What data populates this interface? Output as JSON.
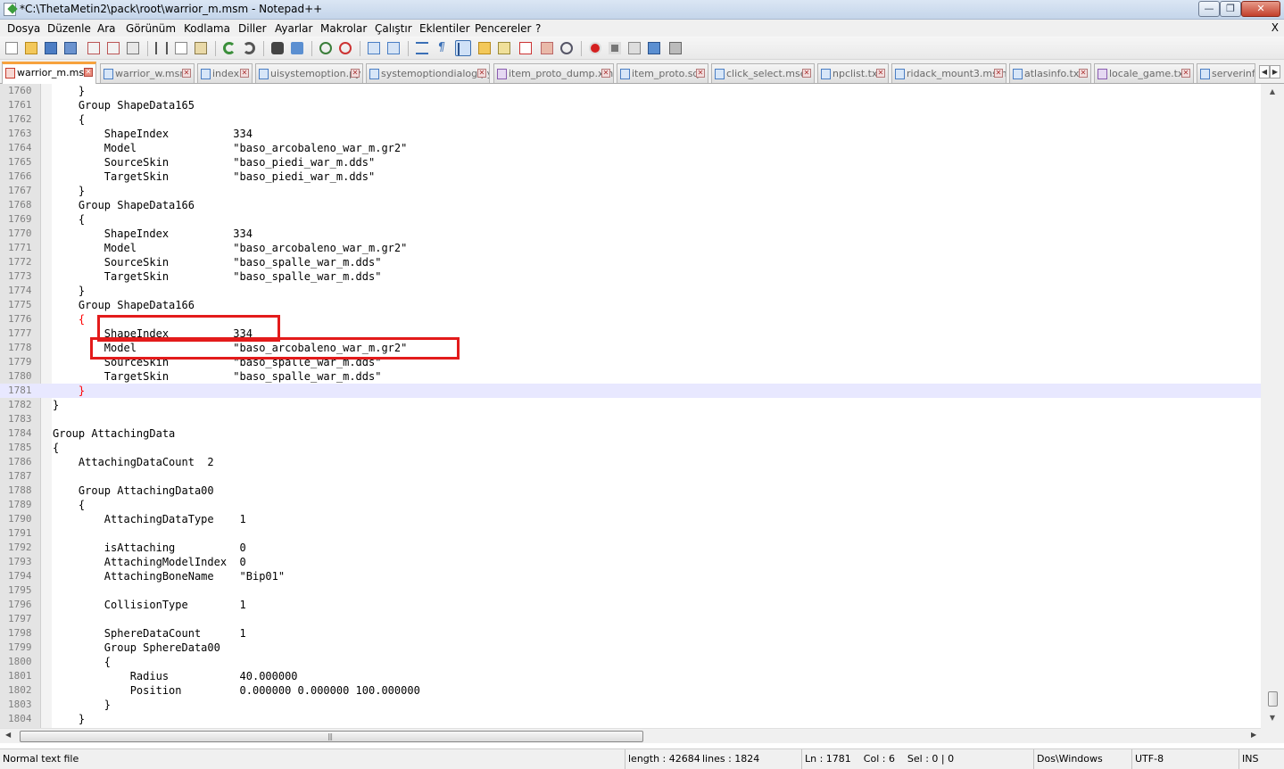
{
  "window": {
    "title": "*C:\\ThetaMetin2\\pack\\root\\warrior_m.msm - Notepad++",
    "buttons": {
      "minimize": "—",
      "maximize": "❐",
      "close": "✕"
    }
  },
  "menu": {
    "items": [
      "Dosya",
      "Düzenle",
      "Ara",
      "Görünüm",
      "Kodlama",
      "Diller",
      "Ayarlar",
      "Makrolar",
      "Çalıştır",
      "Eklentiler",
      "Pencereler",
      "?"
    ],
    "close_label": "X"
  },
  "toolbar": {
    "icons": [
      "new-file-icon",
      "open-file-icon",
      "save-icon",
      "save-all-icon",
      "close-icon",
      "close-all-icon",
      "print-icon",
      "cut-icon",
      "copy-icon",
      "paste-icon",
      "undo-icon",
      "redo-icon",
      "find-icon",
      "replace-icon",
      "zoom-in-icon",
      "zoom-out-icon",
      "sync-vertical-icon",
      "sync-horizontal-icon",
      "word-wrap-icon",
      "show-all-chars-icon",
      "indent-guide-icon",
      "user-language-icon",
      "document-map-icon",
      "function-list-icon",
      "folder-workspace-icon",
      "monitor-icon",
      "record-macro-icon",
      "stop-macro-icon",
      "play-macro-icon",
      "run-macro-multiple-icon",
      "save-macro-icon"
    ],
    "colors": {
      "accent": "#3b6fb0",
      "record": "#d42020"
    }
  },
  "tabs": [
    {
      "label": "warrior_m.msm",
      "active": true
    },
    {
      "label": "warrior_w.msm",
      "active": false
    },
    {
      "label": "index",
      "active": false
    },
    {
      "label": "uisystemoption.py",
      "active": false
    },
    {
      "label": "systemoptiondialog.py",
      "active": false
    },
    {
      "label": "item_proto_dump.xml",
      "active": false
    },
    {
      "label": "item_proto.sql",
      "active": false
    },
    {
      "label": "click_select.mse",
      "active": false
    },
    {
      "label": "npclist.txt",
      "active": false
    },
    {
      "label": "ridack_mount3.msm",
      "active": false
    },
    {
      "label": "atlasinfo.txt",
      "active": false
    },
    {
      "label": "locale_game.txt",
      "active": false
    },
    {
      "label": "serverinfo",
      "active": false
    }
  ],
  "editor": {
    "current_line": 1781,
    "lines": [
      {
        "n": "1760",
        "text": "    }"
      },
      {
        "n": "1761",
        "text": "    Group ShapeData165"
      },
      {
        "n": "1762",
        "text": "    {"
      },
      {
        "n": "1763",
        "text": "        ShapeIndex          334"
      },
      {
        "n": "1764",
        "text": "        Model               \"baso_arcobaleno_war_m.gr2\""
      },
      {
        "n": "1765",
        "text": "        SourceSkin          \"baso_piedi_war_m.dds\""
      },
      {
        "n": "1766",
        "text": "        TargetSkin          \"baso_piedi_war_m.dds\""
      },
      {
        "n": "1767",
        "text": "    }"
      },
      {
        "n": "1768",
        "text": "    Group ShapeData166"
      },
      {
        "n": "1769",
        "text": "    {"
      },
      {
        "n": "1770",
        "text": "        ShapeIndex          334"
      },
      {
        "n": "1771",
        "text": "        Model               \"baso_arcobaleno_war_m.gr2\""
      },
      {
        "n": "1772",
        "text": "        SourceSkin          \"baso_spalle_war_m.dds\""
      },
      {
        "n": "1773",
        "text": "        TargetSkin          \"baso_spalle_war_m.dds\""
      },
      {
        "n": "1774",
        "text": "    }"
      },
      {
        "n": "1775",
        "text": "    Group ShapeData166"
      },
      {
        "n": "1776",
        "text": "    {",
        "brace": true
      },
      {
        "n": "1777",
        "text": "        ShapeIndex          334"
      },
      {
        "n": "1778",
        "text": "        Model               \"baso_arcobaleno_war_m.gr2\""
      },
      {
        "n": "1779",
        "text": "        SourceSkin          \"baso_spalle_war_m.dds\""
      },
      {
        "n": "1780",
        "text": "        TargetSkin          \"baso_spalle_war_m.dds\""
      },
      {
        "n": "1781",
        "text": "    }",
        "brace": true,
        "current": true
      },
      {
        "n": "1782",
        "text": "}"
      },
      {
        "n": "1783",
        "text": ""
      },
      {
        "n": "1784",
        "text": "Group AttachingData"
      },
      {
        "n": "1785",
        "text": "{"
      },
      {
        "n": "1786",
        "text": "    AttachingDataCount  2"
      },
      {
        "n": "1787",
        "text": ""
      },
      {
        "n": "1788",
        "text": "    Group AttachingData00"
      },
      {
        "n": "1789",
        "text": "    {"
      },
      {
        "n": "1790",
        "text": "        AttachingDataType    1"
      },
      {
        "n": "1791",
        "text": ""
      },
      {
        "n": "1792",
        "text": "        isAttaching          0"
      },
      {
        "n": "1793",
        "text": "        AttachingModelIndex  0"
      },
      {
        "n": "1794",
        "text": "        AttachingBoneName    \"Bip01\""
      },
      {
        "n": "1795",
        "text": ""
      },
      {
        "n": "1796",
        "text": "        CollisionType        1"
      },
      {
        "n": "1797",
        "text": ""
      },
      {
        "n": "1798",
        "text": "        SphereDataCount      1"
      },
      {
        "n": "1799",
        "text": "        Group SphereData00"
      },
      {
        "n": "1800",
        "text": "        {"
      },
      {
        "n": "1801",
        "text": "            Radius           40.000000"
      },
      {
        "n": "1802",
        "text": "            Position         0.000000 0.000000 100.000000"
      },
      {
        "n": "1803",
        "text": "        }"
      },
      {
        "n": "1804",
        "text": "    }"
      }
    ],
    "colors": {
      "current_line_bg": "#e8e8ff",
      "brace_match": "#ff0000",
      "annotation_box": "#e31b1b"
    }
  },
  "statusbar": {
    "file_type": "Normal text file",
    "length": "length : 42684",
    "lines": "lines : 1824",
    "position": "Ln : 1781    Col : 6    Sel : 0 | 0",
    "eol": "Dos\\Windows",
    "encoding": "UTF-8",
    "mode": "INS"
  }
}
